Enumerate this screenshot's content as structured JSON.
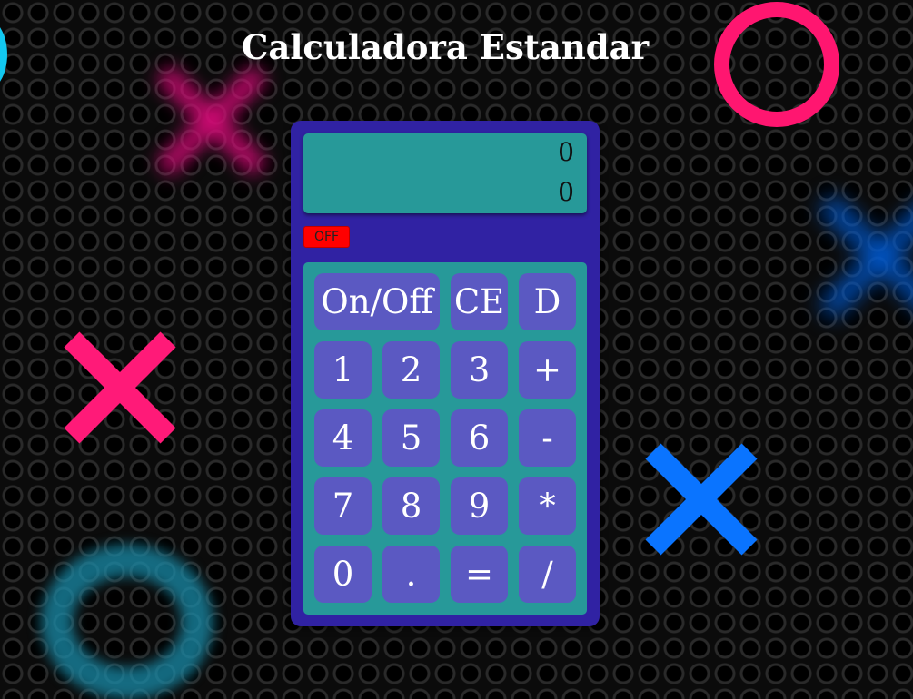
{
  "page": {
    "title": "Calculadora Estandar"
  },
  "display": {
    "previous": "0",
    "current": "0"
  },
  "power_indicator": {
    "label": "OFF",
    "color": "#ff0000"
  },
  "colors": {
    "calculator_body": "#3022a3",
    "screen": "#279999",
    "key": "#5b59c2",
    "background": "#0b0b0b"
  },
  "keys": [
    {
      "label": "On/Off",
      "icon": ""
    },
    {
      "label": "CE"
    },
    {
      "label": "D"
    },
    {
      "label": "1"
    },
    {
      "label": "2"
    },
    {
      "label": "3"
    },
    {
      "label": "+"
    },
    {
      "label": "4"
    },
    {
      "label": "5"
    },
    {
      "label": "6"
    },
    {
      "label": "-"
    },
    {
      "label": "7"
    },
    {
      "label": "8"
    },
    {
      "label": "9"
    },
    {
      "label": "*"
    },
    {
      "label": "0"
    },
    {
      "label": "."
    },
    {
      "label": "="
    },
    {
      "label": "/"
    }
  ]
}
